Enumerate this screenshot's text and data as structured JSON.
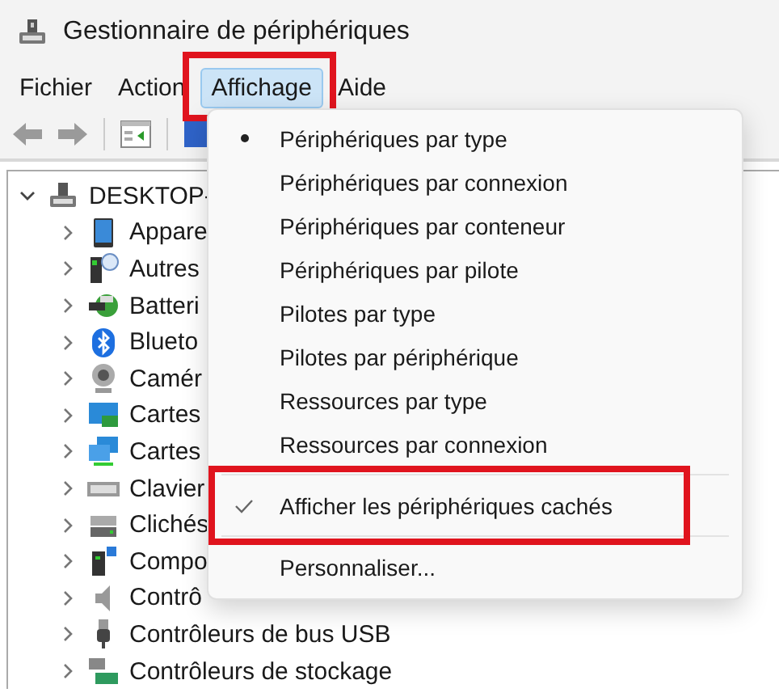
{
  "window": {
    "title": "Gestionnaire de périphériques"
  },
  "menu_bar": [
    {
      "label": "Fichier",
      "selected": false,
      "highlighted": false
    },
    {
      "label": "Action",
      "selected": false,
      "highlighted": false
    },
    {
      "label": "Affichage",
      "selected": true,
      "highlighted": true
    },
    {
      "label": "Aide",
      "selected": false,
      "highlighted": false
    }
  ],
  "tree": {
    "root": {
      "label": "DESKTOP-",
      "expanded": true
    },
    "children": [
      {
        "label": "Appare",
        "expanded": false
      },
      {
        "label": "Autres",
        "expanded": false
      },
      {
        "label": "Batteri",
        "expanded": false
      },
      {
        "label": "Blueto",
        "expanded": false
      },
      {
        "label": "Camér",
        "expanded": false
      },
      {
        "label": "Cartes",
        "expanded": false
      },
      {
        "label": "Cartes",
        "expanded": false
      },
      {
        "label": "Clavier",
        "expanded": false
      },
      {
        "label": "Clichés",
        "expanded": false
      },
      {
        "label": "Compo",
        "expanded": false
      },
      {
        "label": "Contrô",
        "expanded": false
      },
      {
        "label": "Contrôleurs de bus USB",
        "expanded": false
      },
      {
        "label": "Contrôleurs de stockage",
        "expanded": false
      }
    ]
  },
  "dropdown_menu": {
    "items": [
      {
        "kind": "radio",
        "label": "Périphériques par type",
        "selected": true
      },
      {
        "kind": "radio",
        "label": "Périphériques par connexion",
        "selected": false
      },
      {
        "kind": "radio",
        "label": "Périphériques par conteneur",
        "selected": false
      },
      {
        "kind": "radio",
        "label": "Périphériques par pilote",
        "selected": false
      },
      {
        "kind": "radio",
        "label": "Pilotes par type",
        "selected": false
      },
      {
        "kind": "radio",
        "label": "Pilotes par périphérique",
        "selected": false
      },
      {
        "kind": "radio",
        "label": "Ressources par type",
        "selected": false
      },
      {
        "kind": "radio",
        "label": "Ressources par connexion",
        "selected": false
      },
      {
        "kind": "separator"
      },
      {
        "kind": "check",
        "label": "Afficher les périphériques cachés",
        "checked": true,
        "highlighted": true
      },
      {
        "kind": "separator"
      },
      {
        "kind": "plain",
        "label": "Personnaliser..."
      }
    ]
  }
}
